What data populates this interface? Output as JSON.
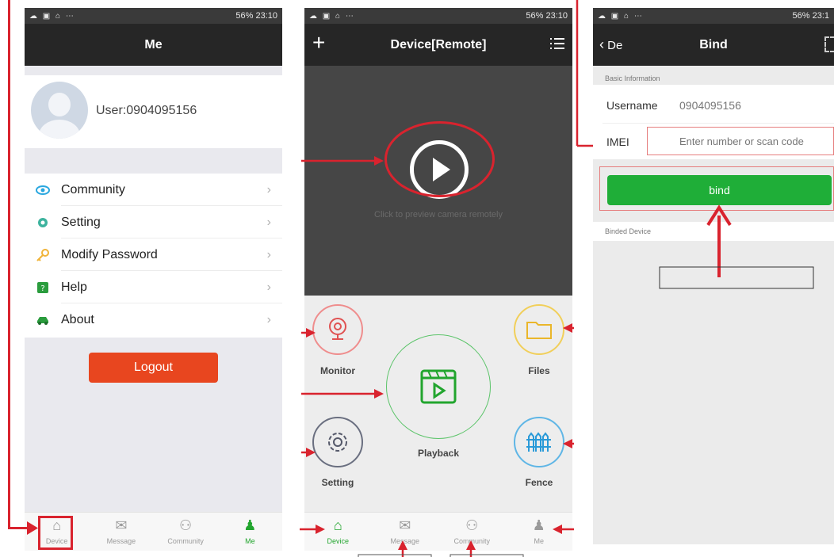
{
  "status": {
    "left_icons": "☁ ▣ ⌂ ⋯",
    "battery": "56%",
    "time": "23:10",
    "time_cut": "23:1"
  },
  "me_screen": {
    "title": "Me",
    "user_label": "User:0904095156",
    "menu": [
      {
        "label": "Community",
        "icon": "eye-icon",
        "color": "#2aa7df"
      },
      {
        "label": "Setting",
        "icon": "gear-icon",
        "color": "#3db39e"
      },
      {
        "label": "Modify Password",
        "icon": "key-icon",
        "color": "#f0b43a"
      },
      {
        "label": "Help",
        "icon": "help-icon",
        "color": "#2a9c3d"
      },
      {
        "label": "About",
        "icon": "car-icon",
        "color": "#2a9c3d"
      }
    ],
    "logout_label": "Logout",
    "logout_color": "#e8461f",
    "tabs": [
      {
        "label": "Device",
        "icon": "home-icon"
      },
      {
        "label": "Message",
        "icon": "mail-icon"
      },
      {
        "label": "Community",
        "icon": "community-icon"
      },
      {
        "label": "Me",
        "icon": "person-icon"
      }
    ]
  },
  "device_screen": {
    "title": "Device[Remote]",
    "add_glyph": "+",
    "preview_text": "Click to preview camera remotely",
    "features": {
      "monitor": "Monitor",
      "files": "Files",
      "playback": "Playback",
      "setting": "Setting",
      "fence": "Fence"
    },
    "tabs": [
      {
        "label": "Device",
        "icon": "home-icon"
      },
      {
        "label": "Message",
        "icon": "mail-icon"
      },
      {
        "label": "Community",
        "icon": "community-icon"
      },
      {
        "label": "Me",
        "icon": "person-icon"
      }
    ]
  },
  "bind_screen": {
    "back_label": "De",
    "title": "Bind",
    "section_basic": "Basic Information",
    "username_label": "Username",
    "username_value": "0904095156",
    "imei_label": "IMEI",
    "imei_placeholder": "Enter number or scan code",
    "bind_label": "bind",
    "bind_color": "#1fae38",
    "section_binded": "Binded Device"
  },
  "colors": {
    "annotation_red": "#d9232e",
    "active_green": "#22a52e"
  }
}
